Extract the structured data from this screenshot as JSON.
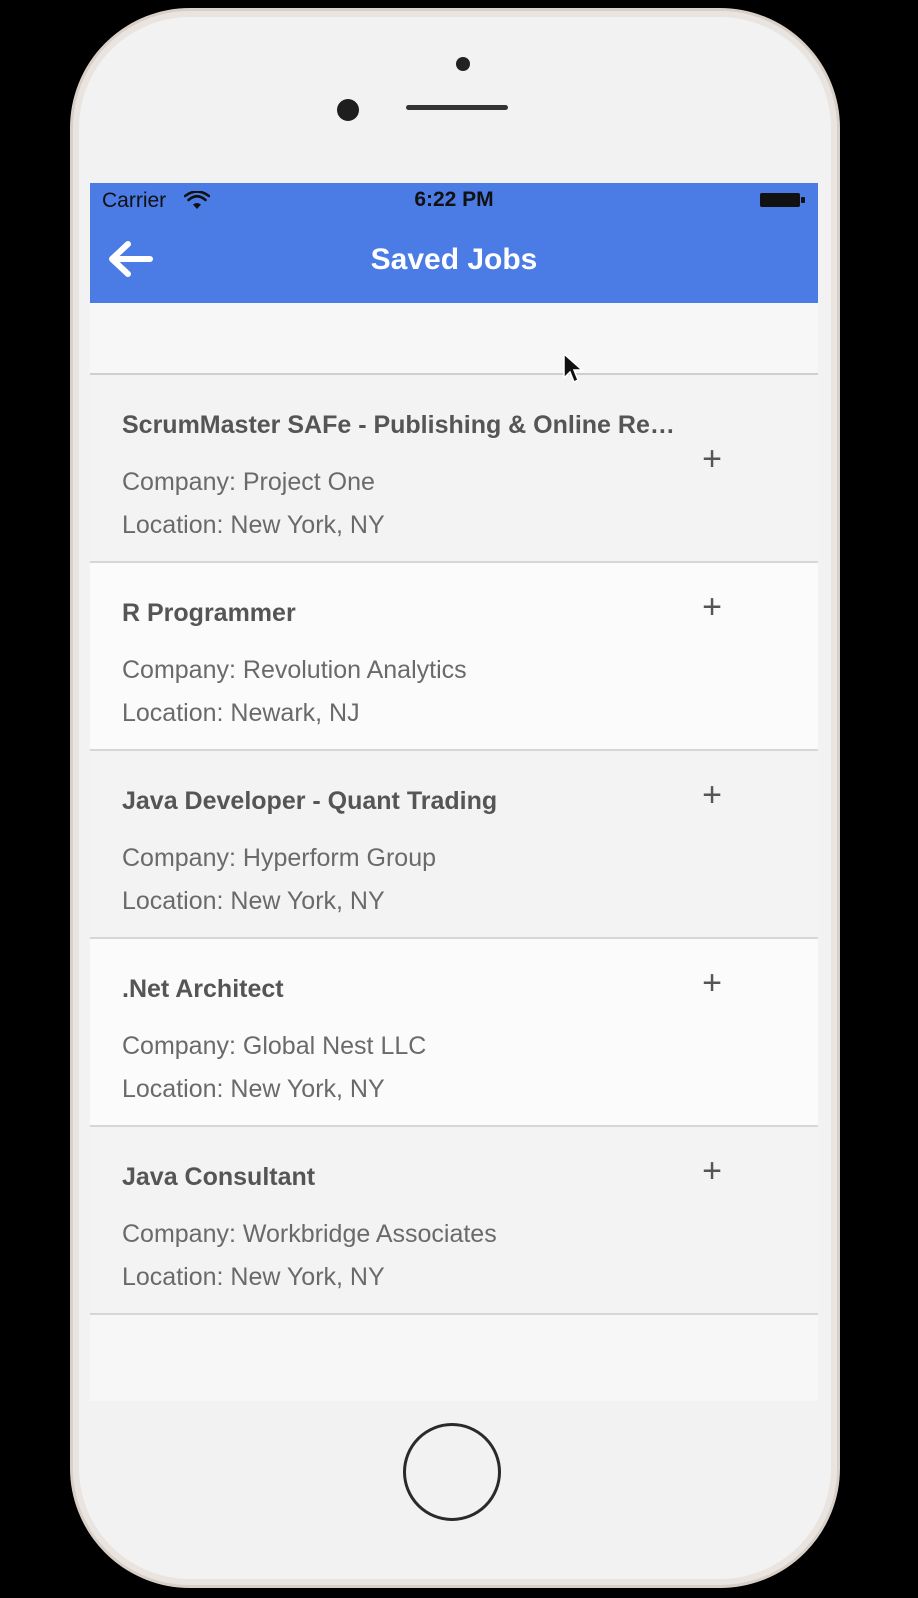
{
  "status_bar": {
    "carrier": "Carrier",
    "time": "6:22 PM"
  },
  "nav": {
    "title": "Saved Jobs",
    "back_icon": "arrow-left-icon"
  },
  "jobs": [
    {
      "title": "ScrumMaster SAFe - Publishing & Online Re…",
      "company": "Company: Project One",
      "location": "Location: New York, NY",
      "action": "+"
    },
    {
      "title": "R Programmer",
      "company": "Company: Revolution Analytics",
      "location": "Location: Newark, NJ",
      "action": "+"
    },
    {
      "title": "Java Developer - Quant Trading",
      "company": "Company: Hyperform Group",
      "location": "Location: New York, NY",
      "action": "+"
    },
    {
      "title": ".Net Architect",
      "company": "Company: Global Nest LLC",
      "location": "Location: New York, NY",
      "action": "+"
    },
    {
      "title": "Java Consultant",
      "company": "Company: Workbridge Associates",
      "location": "Location: New York, NY",
      "action": "+"
    }
  ],
  "colors": {
    "nav_background": "#4b7be5",
    "nav_text": "#ffffff",
    "title_text": "#555555",
    "meta_text": "#6a6a6a"
  }
}
